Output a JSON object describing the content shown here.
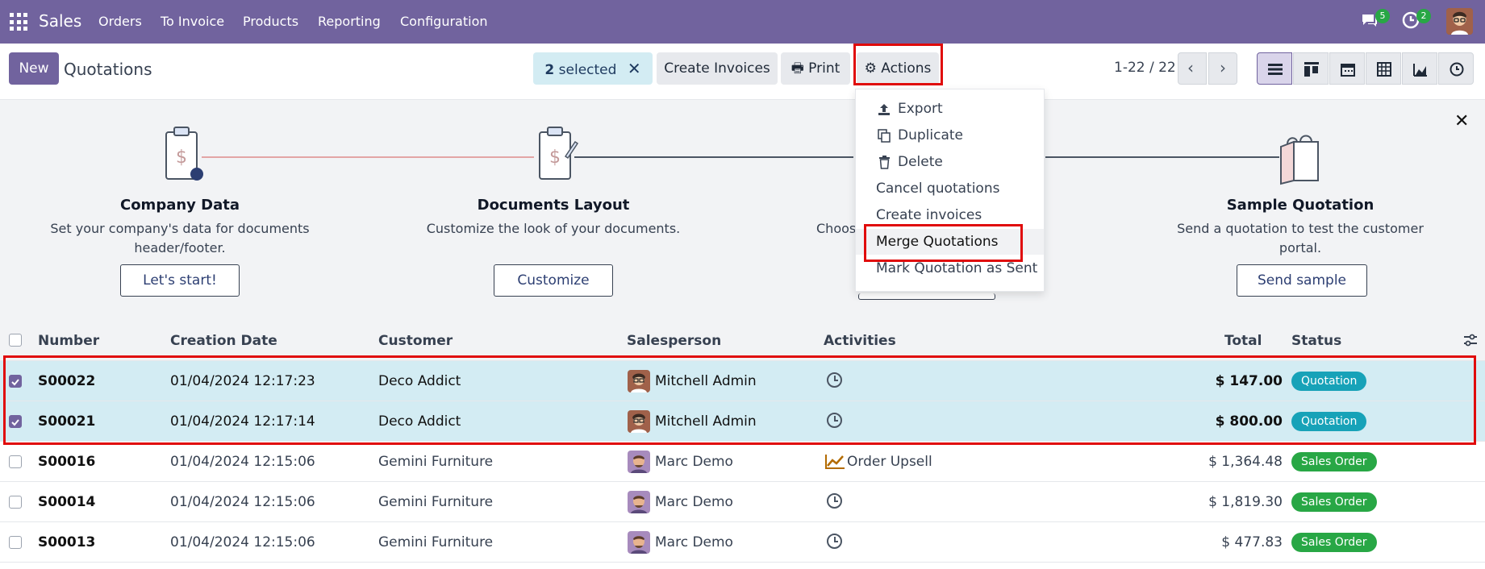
{
  "nav": {
    "brand": "Sales",
    "menu": [
      "Orders",
      "To Invoice",
      "Products",
      "Reporting",
      "Configuration"
    ],
    "messages_count": "5",
    "activities_count": "2"
  },
  "control_panel": {
    "new_label": "New",
    "title": "Quotations",
    "selected_count": "2",
    "selected_label": "selected",
    "create_invoices_label": "Create Invoices",
    "print_label": "Print",
    "actions_label": "Actions",
    "pager": "1-22 / 22"
  },
  "banner": {
    "steps": [
      {
        "title": "Company Data",
        "desc": "Set your company's data for documents header/footer.",
        "button": "Let's start!"
      },
      {
        "title": "Documents Layout",
        "desc": "Customize the look of your documents.",
        "button": "Customize"
      },
      {
        "title": "",
        "desc": "Choose",
        "button": ""
      },
      {
        "title": "Sample Quotation",
        "desc": "Send a quotation to test the customer portal.",
        "button": "Send sample"
      }
    ]
  },
  "actions_menu": {
    "items": [
      "Export",
      "Duplicate",
      "Delete",
      "Cancel quotations",
      "Create invoices",
      "Merge Quotations",
      "Mark Quotation as Sent"
    ]
  },
  "table": {
    "columns": [
      "Number",
      "Creation Date",
      "Customer",
      "Salesperson",
      "Activities",
      "Total",
      "Status"
    ],
    "rows": [
      {
        "number": "S00022",
        "date": "01/04/2024 12:17:23",
        "customer": "Deco Addict",
        "salesperson": "Mitchell Admin",
        "activity": "",
        "total": "$ 147.00",
        "status": "Quotation",
        "selected": true
      },
      {
        "number": "S00021",
        "date": "01/04/2024 12:17:14",
        "customer": "Deco Addict",
        "salesperson": "Mitchell Admin",
        "activity": "",
        "total": "$ 800.00",
        "status": "Quotation",
        "selected": true
      },
      {
        "number": "S00016",
        "date": "01/04/2024 12:15:06",
        "customer": "Gemini Furniture",
        "salesperson": "Marc Demo",
        "activity": "Order Upsell",
        "total": "$ 1,364.48",
        "status": "Sales Order",
        "selected": false
      },
      {
        "number": "S00014",
        "date": "01/04/2024 12:15:06",
        "customer": "Gemini Furniture",
        "salesperson": "Marc Demo",
        "activity": "",
        "total": "$ 1,819.30",
        "status": "Sales Order",
        "selected": false
      },
      {
        "number": "S00013",
        "date": "01/04/2024 12:15:06",
        "customer": "Gemini Furniture",
        "salesperson": "Marc Demo",
        "activity": "",
        "total": "$ 477.83",
        "status": "Sales Order",
        "selected": false
      }
    ]
  },
  "colors": {
    "brand": "#71639e",
    "quotation_badge": "#17a2b8",
    "sales_order_badge": "#28a745",
    "selected_row": "#d3ecf3",
    "highlight": "#e00b0b"
  }
}
